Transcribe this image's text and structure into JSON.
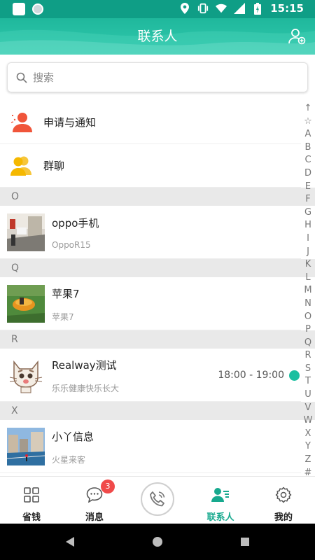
{
  "status_bar": {
    "time": "15:15"
  },
  "app_bar": {
    "title": "联系人",
    "action_icon": "add-contact-icon"
  },
  "search": {
    "placeholder": "搜索"
  },
  "special_items": [
    {
      "label": "申请与通知",
      "icon": "notification-person-icon",
      "color": "#f0553a"
    },
    {
      "label": "群聊",
      "icon": "group-icon",
      "color": "#f5b800"
    }
  ],
  "sections": [
    {
      "letter": "O",
      "contacts": [
        {
          "name": "oppo手机",
          "sub": "OppoR15",
          "time": ""
        }
      ]
    },
    {
      "letter": "Q",
      "contacts": [
        {
          "name": "苹果7",
          "sub": "苹果7",
          "time": ""
        }
      ]
    },
    {
      "letter": "R",
      "contacts": [
        {
          "name": "Realway测试",
          "sub": "乐乐健康快乐长大",
          "time": "18:00 - 19:00"
        }
      ]
    },
    {
      "letter": "X",
      "contacts": [
        {
          "name": "小丫信息",
          "sub": "火星来客",
          "time": ""
        }
      ]
    }
  ],
  "index_letters": [
    "↑",
    "☆",
    "A",
    "B",
    "C",
    "D",
    "E",
    "F",
    "G",
    "H",
    "I",
    "J",
    "K",
    "L",
    "M",
    "N",
    "O",
    "P",
    "Q",
    "R",
    "S",
    "T",
    "U",
    "V",
    "W",
    "X",
    "Y",
    "Z",
    "#"
  ],
  "bottom_nav": [
    {
      "label": "省钱",
      "icon": "grid-icon"
    },
    {
      "label": "消息",
      "icon": "chat-icon",
      "badge": "3"
    },
    {
      "label": "",
      "icon": "phone-call-icon"
    },
    {
      "label": "联系人",
      "icon": "contacts-icon",
      "active": true
    },
    {
      "label": "我的",
      "icon": "settings-icon"
    }
  ],
  "colors": {
    "accent": "#17a98e",
    "status_bar": "#0f9e86",
    "badge": "#f04a4a",
    "online_dot": "#1bbfa0"
  }
}
